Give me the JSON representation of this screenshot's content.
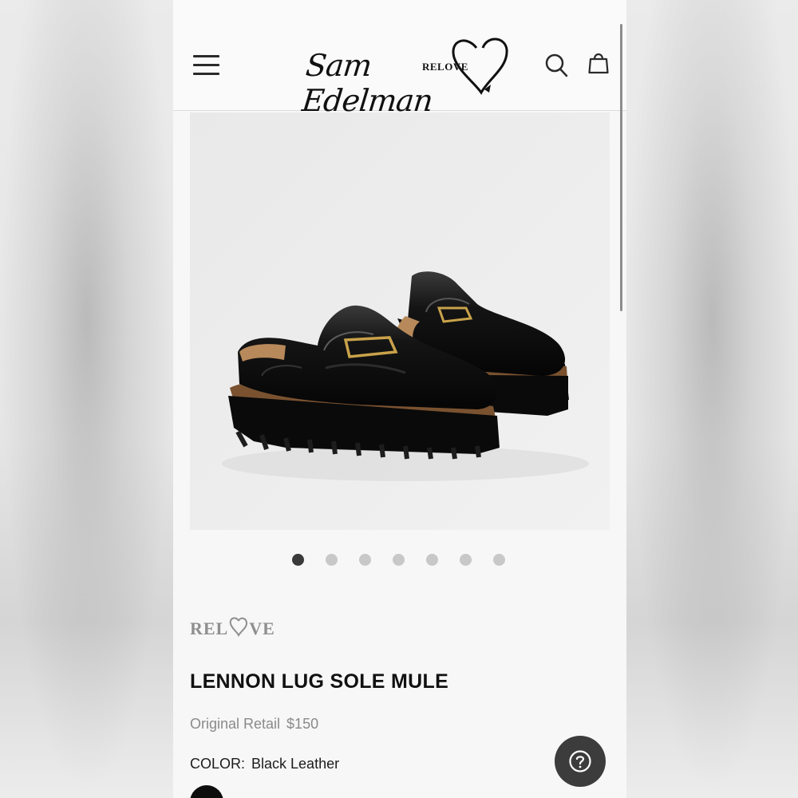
{
  "header": {
    "logo_script": "Sam Edelman",
    "logo_relove": "RELOVE",
    "icons": [
      "menu-icon",
      "search-icon",
      "bag-icon"
    ]
  },
  "gallery": {
    "image_description": "black leather lug sole loafer mules with gold horsebit hardware",
    "slide_count": 7,
    "active_slide": 1
  },
  "product": {
    "brand_badge": {
      "pre": "REL",
      "post": "VE"
    },
    "title": "LENNON LUG SOLE MULE",
    "retail_label": "Original Retail",
    "retail_price": "$150",
    "color_label": "COLOR:",
    "color_value": "Black Leather",
    "swatch_color": "#0d0d0d"
  },
  "help": {
    "icon": "question-mark-icon"
  },
  "colors": {
    "page_bg": "#f7f7f7",
    "text_dark": "#111111",
    "text_muted": "#8a8a8a",
    "dot_active": "#3a3a3a",
    "dot_inactive": "#c8c8c8",
    "help_bg": "#3c3c3c"
  }
}
